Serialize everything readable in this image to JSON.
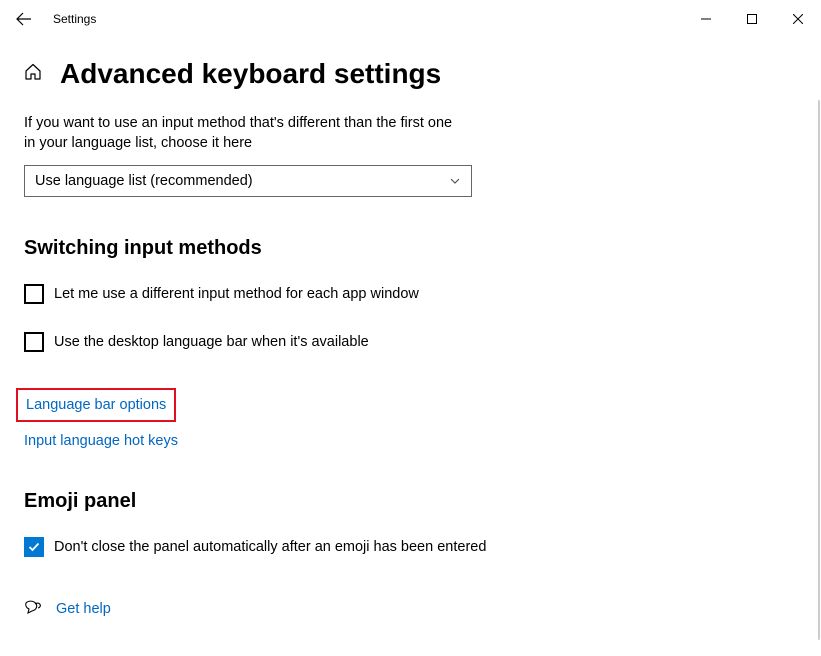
{
  "app_title": "Settings",
  "page_title": "Advanced keyboard settings",
  "intro": "If you want to use an input method that's different than the first one in your language list, choose it here",
  "dropdown_selected": "Use language list (recommended)",
  "sections": {
    "switching": {
      "heading": "Switching input methods",
      "cb1": "Let me use a different input method for each app window",
      "cb2": "Use the desktop language bar when it's available",
      "link1": "Language bar options",
      "link2": "Input language hot keys"
    },
    "emoji": {
      "heading": "Emoji panel",
      "cb1": "Don't close the panel automatically after an emoji has been entered"
    }
  },
  "get_help": "Get help"
}
